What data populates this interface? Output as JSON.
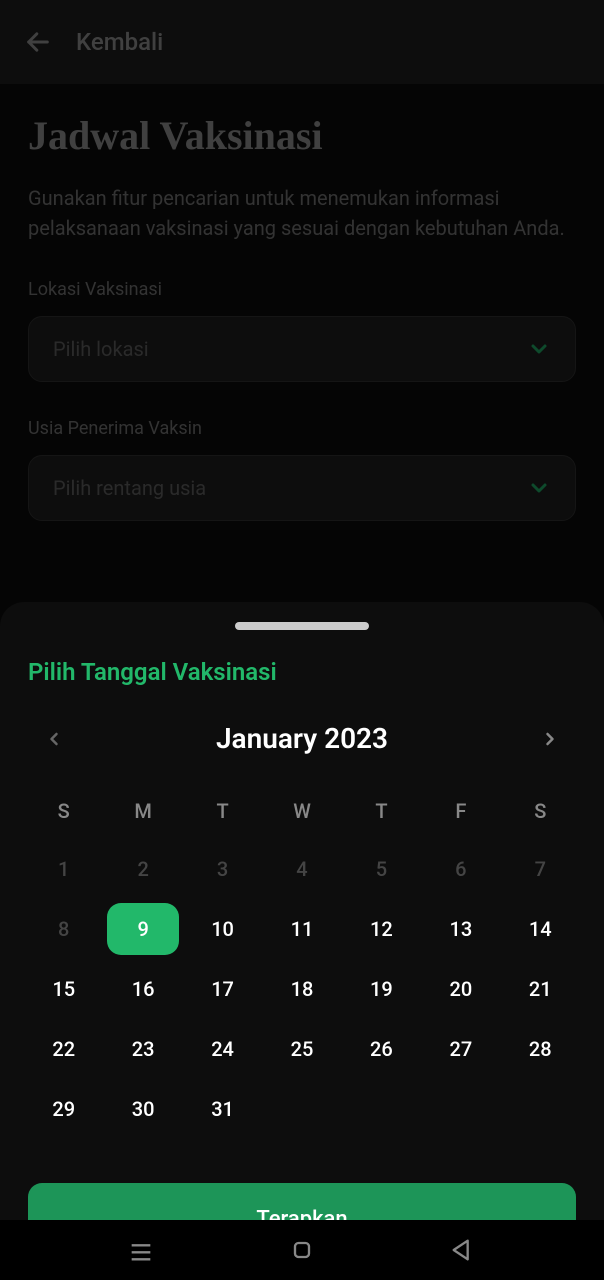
{
  "header": {
    "back_label": "Kembali"
  },
  "page": {
    "title": "Jadwal Vaksinasi",
    "description": "Gunakan fitur pencarian untuk menemukan informasi pelaksanaan vaksinasi yang sesuai dengan kebutuhan Anda."
  },
  "fields": {
    "location": {
      "label": "Lokasi Vaksinasi",
      "placeholder": "Pilih lokasi"
    },
    "age": {
      "label": "Usia Penerima Vaksin",
      "placeholder": "Pilih rentang usia"
    }
  },
  "sheet": {
    "title": "Pilih Tanggal Vaksinasi",
    "month_label": "January 2023",
    "day_headers": [
      "S",
      "M",
      "T",
      "W",
      "T",
      "F",
      "S"
    ],
    "days": [
      {
        "n": 1,
        "disabled": true
      },
      {
        "n": 2,
        "disabled": true
      },
      {
        "n": 3,
        "disabled": true
      },
      {
        "n": 4,
        "disabled": true
      },
      {
        "n": 5,
        "disabled": true
      },
      {
        "n": 6,
        "disabled": true
      },
      {
        "n": 7,
        "disabled": true
      },
      {
        "n": 8,
        "disabled": true
      },
      {
        "n": 9,
        "selected": true
      },
      {
        "n": 10
      },
      {
        "n": 11
      },
      {
        "n": 12
      },
      {
        "n": 13
      },
      {
        "n": 14
      },
      {
        "n": 15
      },
      {
        "n": 16
      },
      {
        "n": 17
      },
      {
        "n": 18
      },
      {
        "n": 19
      },
      {
        "n": 20
      },
      {
        "n": 21
      },
      {
        "n": 22
      },
      {
        "n": 23
      },
      {
        "n": 24
      },
      {
        "n": 25
      },
      {
        "n": 26
      },
      {
        "n": 27
      },
      {
        "n": 28
      },
      {
        "n": 29
      },
      {
        "n": 30
      },
      {
        "n": 31
      }
    ],
    "apply_label": "Terapkan"
  },
  "colors": {
    "accent": "#22b86a",
    "button": "#1d9558"
  }
}
